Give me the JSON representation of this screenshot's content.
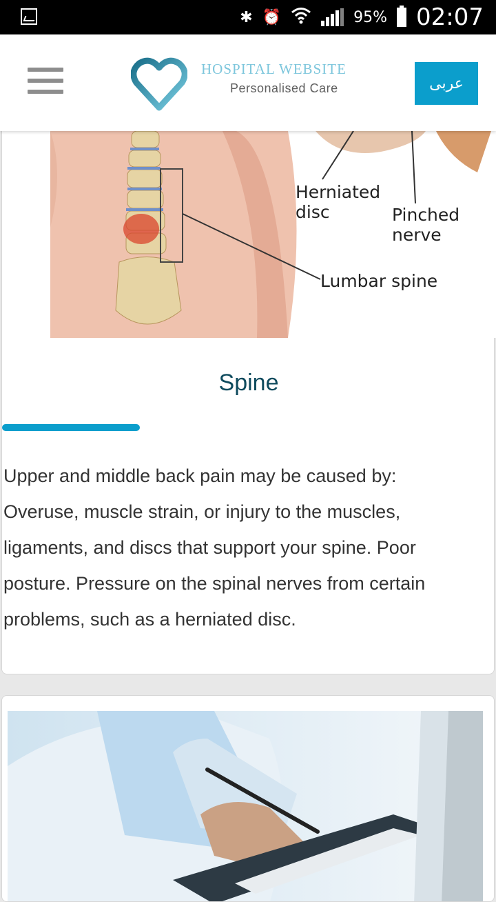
{
  "status_bar": {
    "battery_percent": "95%",
    "time": "02:07",
    "icons": [
      "gallery-icon",
      "bluetooth-icon",
      "alarm-icon",
      "wifi-icon",
      "signal-icon",
      "battery-icon"
    ]
  },
  "header": {
    "brand_title": "HOSPITAL WEBSITE",
    "brand_subtitle": "Personalised Care",
    "language_button": "عربى",
    "colors": {
      "accent": "#0b9ecc",
      "brand_text": "#7dc6dc"
    }
  },
  "card": {
    "image_labels": {
      "herniated_disc_line1": "Herniated",
      "herniated_disc_line2": "disc",
      "pinched_nerve_line1": "Pinched",
      "pinched_nerve_line2": "nerve",
      "lumbar_spine": "Lumbar spine"
    },
    "title": "Spine",
    "description": "Upper and middle back pain may be caused by: Overuse, muscle strain, or injury to the muscles, ligaments, and discs that support your spine. Poor posture. Pressure on the spinal nerves from certain problems, such as a herniated disc."
  }
}
